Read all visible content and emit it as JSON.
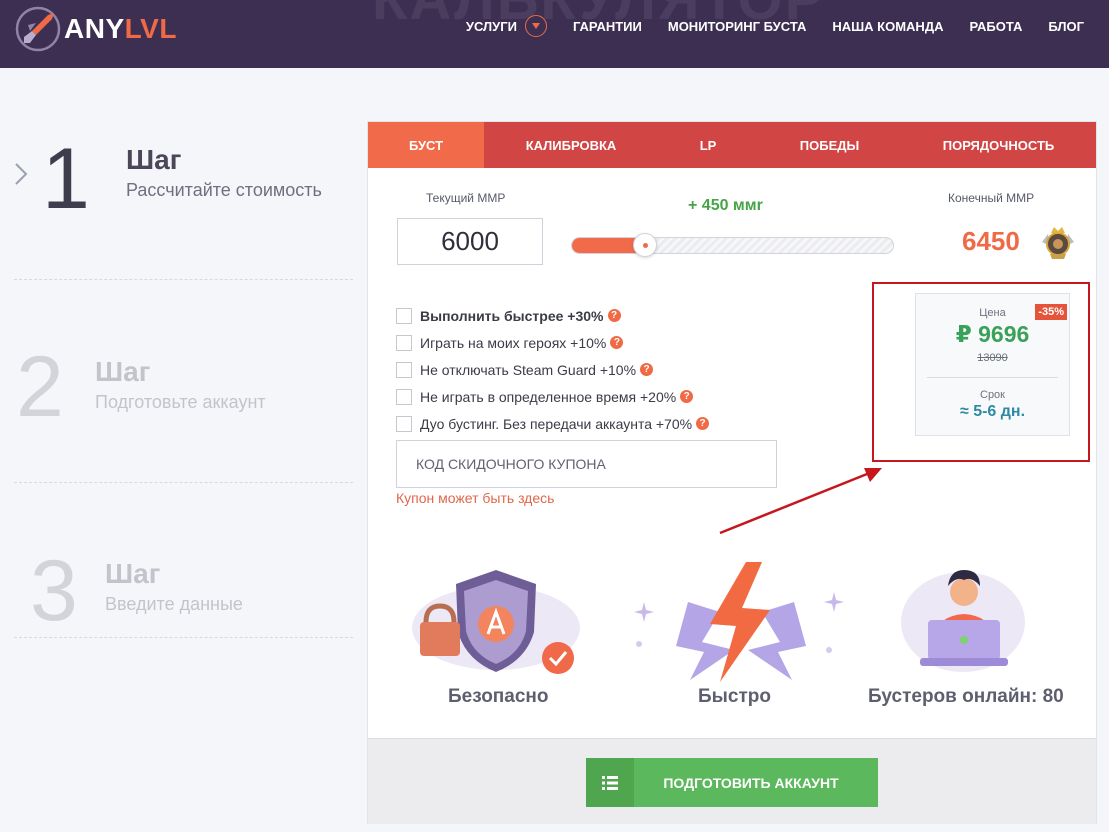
{
  "header": {
    "ghost_title": "КАЛЬКУЛЯТОР",
    "logo_text_main": "ANY",
    "logo_text_accent": "LVL",
    "nav": [
      {
        "label": "УСЛУГИ",
        "has_dropdown": true
      },
      {
        "label": "ГАРАНТИИ"
      },
      {
        "label": "МОНИТОРИНГ БУСТА"
      },
      {
        "label": "НАША КОМАНДА"
      },
      {
        "label": "РАБОТА"
      },
      {
        "label": "БЛОГ"
      }
    ]
  },
  "steps": [
    {
      "number": "1",
      "title": "Шаг",
      "subtitle": "Рассчитайте стоимость",
      "active": true
    },
    {
      "number": "2",
      "title": "Шаг",
      "subtitle": "Подготовьте аккаунт",
      "active": false
    },
    {
      "number": "3",
      "title": "Шаг",
      "subtitle": "Введите данные",
      "active": false
    }
  ],
  "tabs": [
    {
      "label": "БУСТ",
      "active": true
    },
    {
      "label": "КАЛИБРОВКА",
      "active": false
    },
    {
      "label": "LP",
      "active": false
    },
    {
      "label": "ПОБЕДЫ",
      "active": false
    },
    {
      "label": "ПОРЯДОЧНОСТЬ",
      "active": false
    }
  ],
  "calculator": {
    "current_label": "Текущий MMP",
    "current_value": "6000",
    "target_label": "Конечный MMP",
    "target_value": "6450",
    "delta": "+ 450 ммr",
    "slider_fraction": 0.23,
    "options": [
      {
        "label": "Выполнить быстрее +30%",
        "bold": true,
        "checked": false
      },
      {
        "label": "Играть на моих героях +10%",
        "bold": false,
        "checked": false
      },
      {
        "label": "Не отключать Steam Guard +10%",
        "bold": false,
        "checked": false
      },
      {
        "label": "Не играть в определенное время +20%",
        "bold": false,
        "checked": false
      },
      {
        "label": "Дуо бустинг. Без передачи аккаунта +70%",
        "bold": false,
        "checked": false
      }
    ],
    "help_glyph": "?",
    "coupon_placeholder": "КОД СКИДОЧНОГО КУПОНА",
    "coupon_hint": "Купон может быть здесь"
  },
  "price": {
    "label": "Цена",
    "discount": "-35%",
    "value": "₽ 9696",
    "old_value": "13090",
    "term_label": "Срок",
    "term_value": "≈ 5-6 дн."
  },
  "features": [
    {
      "label": "Безопасно",
      "icon": "shield-lock-icon"
    },
    {
      "label": "Быстро",
      "icon": "lightning-icon"
    },
    {
      "label": "Бустеров онлайн: 80",
      "icon": "booster-laptop-icon"
    }
  ],
  "cta": {
    "label": "ПОДГОТОВИТЬ АККАУНТ",
    "icon": "list-icon"
  },
  "colors": {
    "header_bg": "#3d2f52",
    "tab_bg": "#d24545",
    "tab_active": "#f16a4a",
    "accent_orange": "#ef6a45",
    "price_green": "#3aa15a",
    "term_blue": "#2e8aa4",
    "cta_green": "#5cb85c",
    "annotation_red": "#c6161e"
  }
}
